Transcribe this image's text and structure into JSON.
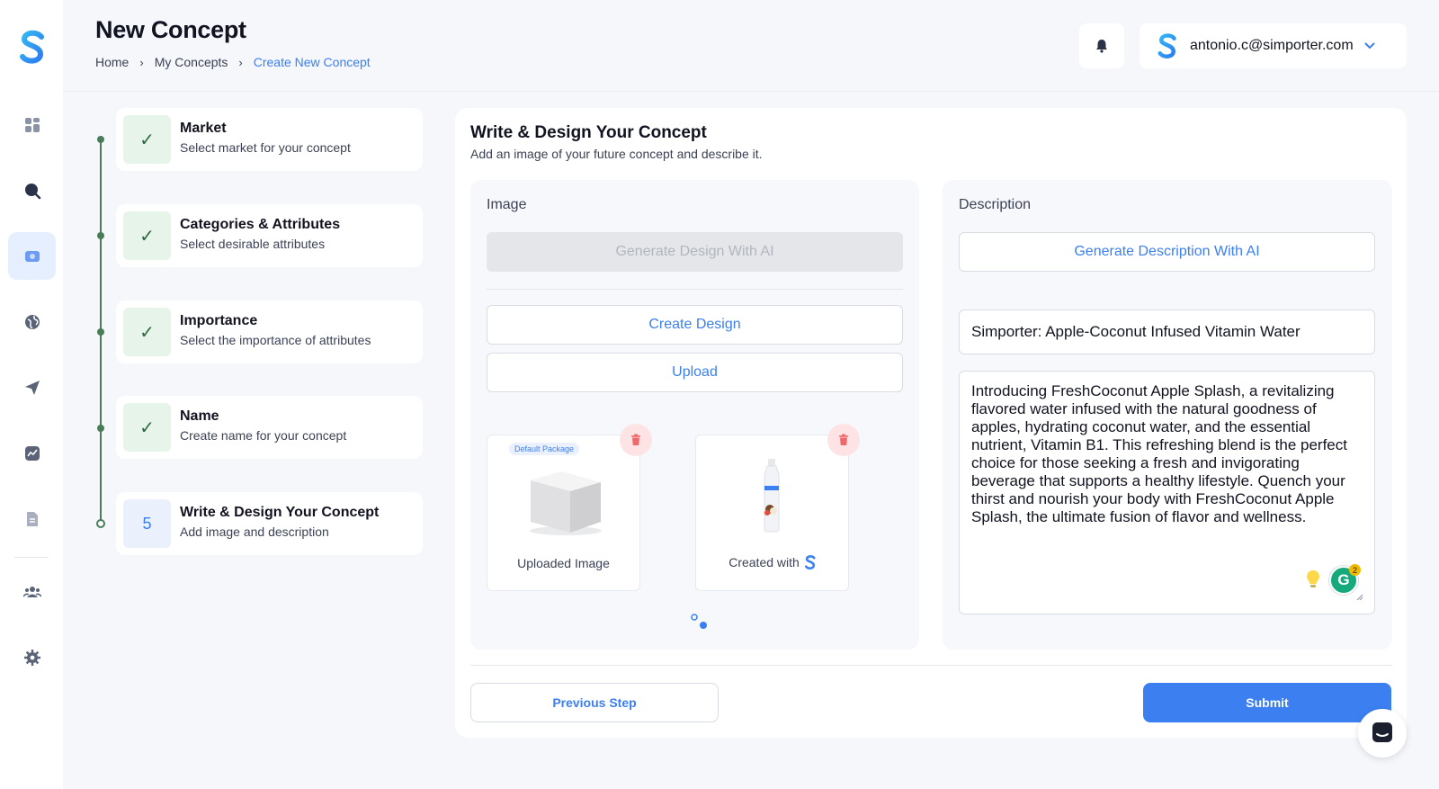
{
  "header": {
    "title": "New Concept",
    "breadcrumb": [
      "Home",
      "My Concepts",
      "Create New Concept"
    ],
    "user_email": "antonio.c@simporter.com"
  },
  "sidebar": {
    "items": [
      {
        "icon": "dashboard-icon"
      },
      {
        "icon": "search-icon"
      },
      {
        "icon": "concept-icon",
        "active": true
      },
      {
        "icon": "globe-icon"
      },
      {
        "icon": "send-icon"
      },
      {
        "icon": "analytics-icon"
      },
      {
        "icon": "document-icon"
      },
      {
        "icon": "team-icon"
      },
      {
        "icon": "settings-icon"
      }
    ]
  },
  "steps": [
    {
      "title": "Market",
      "subtitle": "Select market for your concept",
      "status": "done",
      "badge": "✓"
    },
    {
      "title": "Categories & Attributes",
      "subtitle": "Select desirable attributes",
      "status": "done",
      "badge": "✓"
    },
    {
      "title": "Importance",
      "subtitle": "Select the importance of attributes",
      "status": "done",
      "badge": "✓"
    },
    {
      "title": "Name",
      "subtitle": "Create name for your concept",
      "status": "done",
      "badge": "✓"
    },
    {
      "title": "Write & Design Your Concept",
      "subtitle": "Add image and description",
      "status": "current",
      "badge": "5"
    }
  ],
  "main": {
    "title": "Write & Design Your Concept",
    "subtitle": "Add an image of your future concept and describe it.",
    "image_panel": {
      "label": "Image",
      "generate_label": "Generate Design With AI",
      "create_label": "Create Design",
      "upload_label": "Upload",
      "thumbnails": [
        {
          "caption": "Uploaded Image",
          "tag": "Default Package"
        },
        {
          "caption": "Created with"
        }
      ]
    },
    "description_panel": {
      "label": "Description",
      "generate_label": "Generate Description With AI",
      "title_value": "Simporter: Apple-Coconut Infused Vitamin Water",
      "description_value": "Introducing FreshCoconut Apple Splash, a revitalizing flavored water infused with the natural goodness of apples, hydrating coconut water, and the essential nutrient, Vitamin B1. This refreshing blend is the perfect choice for those seeking a fresh and invigorating beverage that supports a healthy lifestyle. Quench your thirst and nourish your body with FreshCoconut Apple Splash, the ultimate fusion of flavor and wellness.",
      "grammarly_count": "2"
    },
    "previous_label": "Previous Step",
    "submit_label": "Submit"
  },
  "colors": {
    "accent": "#3b7ff0",
    "success": "#4a7c59",
    "danger": "#f0686a"
  }
}
